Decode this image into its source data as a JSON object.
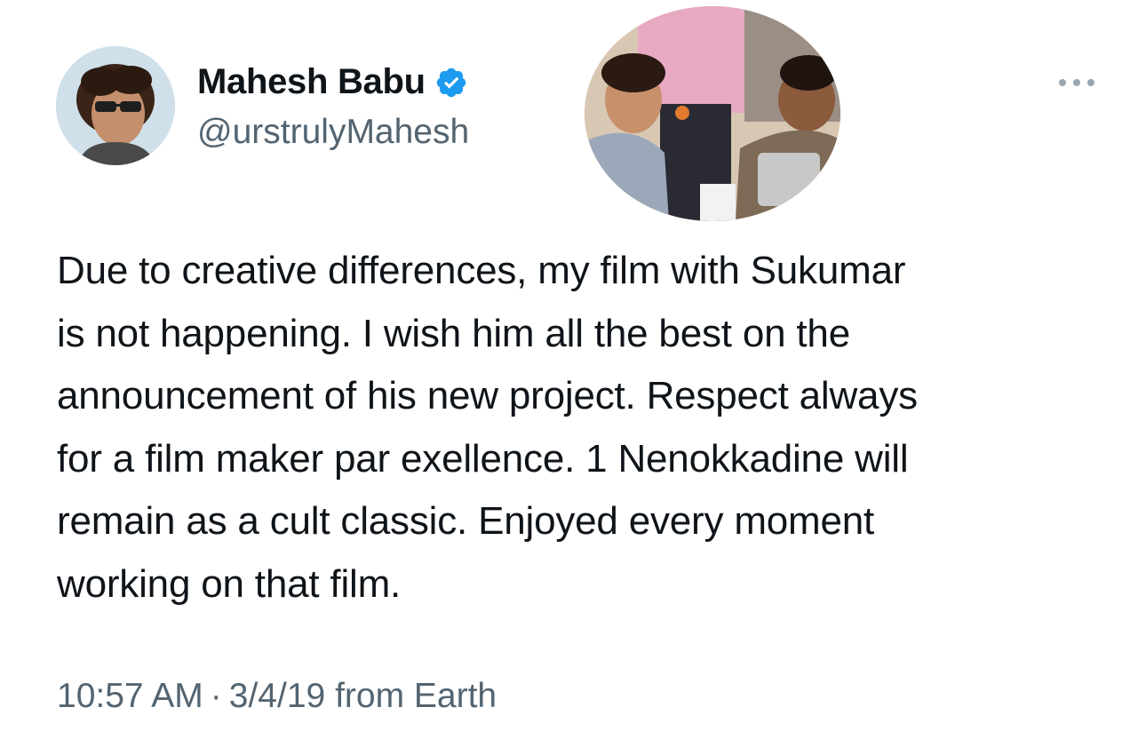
{
  "author": {
    "display_name": "Mahesh Babu",
    "handle": "@urstrulyMahesh",
    "verified": true,
    "verified_icon": "verified-badge-icon",
    "accent_color": "#1d9bf0"
  },
  "menu": {
    "icon": "more-options-icon"
  },
  "tweet": {
    "lines": [
      "Due to creative differences, my film with Sukumar",
      "is not happening. I wish him all the best on the",
      "announcement of his new project. Respect always",
      "for a film maker par exellence. 1 Nenokkadine will",
      "remain as a cult classic. Enjoyed every moment",
      "working on that film."
    ],
    "time": "10:57 AM",
    "separator": "·",
    "date": "3/4/19",
    "source": "from Earth"
  },
  "colors": {
    "text_primary": "#0f1419",
    "text_secondary": "#536471",
    "background": "#ffffff"
  }
}
